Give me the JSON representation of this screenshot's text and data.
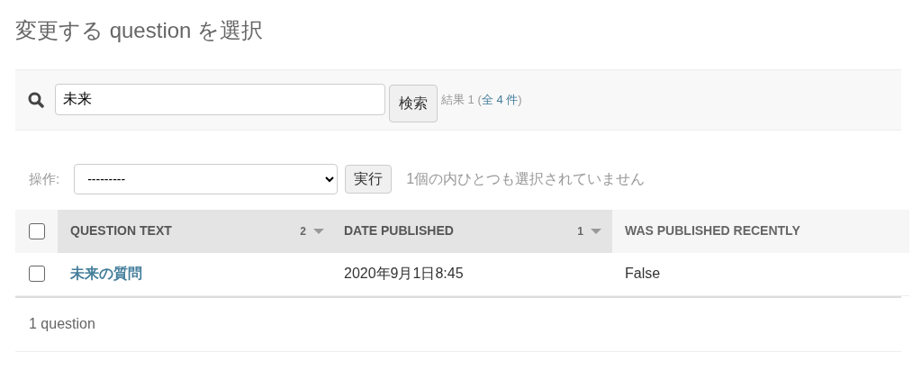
{
  "title": "変更する question を選択",
  "search": {
    "value": "未来",
    "button": "検索",
    "result_prefix": "結果 1 (",
    "result_link": "全 4 件",
    "result_suffix": ")"
  },
  "actions": {
    "label": "操作:",
    "value": "---------",
    "button": "実行",
    "selection_note": "1個の内ひとつも選択されていません"
  },
  "table": {
    "select_all_checked": false,
    "columns": [
      {
        "label": "QUESTION TEXT",
        "sorted": true,
        "sort_priority": "2"
      },
      {
        "label": "DATE PUBLISHED",
        "sorted": true,
        "sort_priority": "1"
      },
      {
        "label": "WAS PUBLISHED RECENTLY",
        "sorted": false
      }
    ],
    "rows": [
      {
        "checked": false,
        "question_text": "未来の質問",
        "date_published": "2020年9月1日8:45",
        "was_published_recently": "False"
      }
    ]
  },
  "footer": "1 question"
}
